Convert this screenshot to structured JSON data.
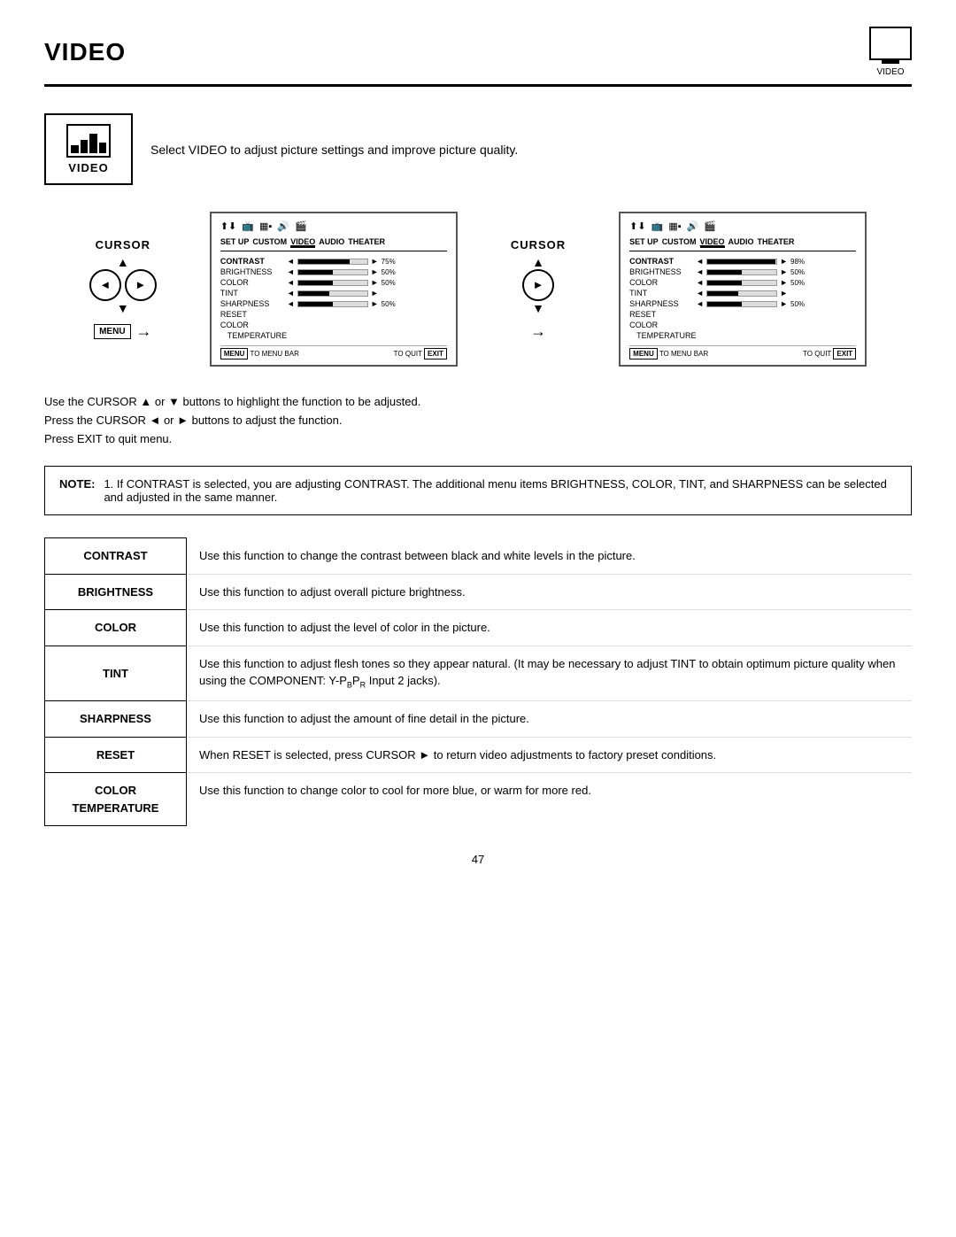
{
  "header": {
    "title": "VIDEO",
    "icon_label": "VIDEO"
  },
  "intro": {
    "video_label": "VIDEO",
    "description": "Select VIDEO to adjust picture settings and improve picture quality."
  },
  "diagram": {
    "cursor_label": "CURSOR",
    "menu_tag": "MENU",
    "screen1": {
      "nav": [
        "SET UP",
        "CUSTOM",
        "VIDEO",
        "AUDIO",
        "THEATER"
      ],
      "active_tab": "VIDEO",
      "rows": [
        {
          "label": "CONTRAST",
          "bold": true,
          "value": 75,
          "display": "75%"
        },
        {
          "label": "BRIGHTNESS",
          "bold": false,
          "value": 50,
          "display": "50%"
        },
        {
          "label": "COLOR",
          "bold": false,
          "value": 50,
          "display": "50%"
        },
        {
          "label": "TINT",
          "bold": false,
          "value": 40,
          "display": ""
        },
        {
          "label": "SHARPNESS",
          "bold": false,
          "value": 50,
          "display": "50%"
        },
        {
          "label": "RESET",
          "bold": false,
          "value": 0,
          "display": ""
        },
        {
          "label": "COLOR",
          "bold": false,
          "value": 0,
          "display": ""
        },
        {
          "label": "TEMPERATURE",
          "bold": false,
          "value": 0,
          "display": ""
        }
      ],
      "bottom_left": "MENU",
      "bottom_left_text": "TO MENU BAR",
      "bottom_right": "EXIT",
      "bottom_right_text": "TO QUIT"
    },
    "screen2": {
      "nav": [
        "SET UP",
        "CUSTOM",
        "VIDEO",
        "AUDIO",
        "THEATER"
      ],
      "active_tab": "VIDEO",
      "rows": [
        {
          "label": "CONTRAST",
          "bold": true,
          "value": 98,
          "display": "98%"
        },
        {
          "label": "BRIGHTNESS",
          "bold": false,
          "value": 50,
          "display": "50%"
        },
        {
          "label": "COLOR",
          "bold": false,
          "value": 50,
          "display": "50%"
        },
        {
          "label": "TINT",
          "bold": false,
          "value": 40,
          "display": ""
        },
        {
          "label": "SHARPNESS",
          "bold": false,
          "value": 50,
          "display": "50%"
        },
        {
          "label": "RESET",
          "bold": false,
          "value": 0,
          "display": ""
        },
        {
          "label": "COLOR",
          "bold": false,
          "value": 0,
          "display": ""
        },
        {
          "label": "TEMPERATURE",
          "bold": false,
          "value": 0,
          "display": ""
        }
      ],
      "bottom_left": "MENU",
      "bottom_left_text": "TO MENU BAR",
      "bottom_right": "EXIT",
      "bottom_right_text": "TO QUIT"
    }
  },
  "instructions": [
    "Use the CURSOR ▲ or ▼ buttons to highlight the function to be adjusted.",
    "Press the CURSOR ◄ or ► buttons to adjust the function.",
    "Press EXIT to quit menu."
  ],
  "note": {
    "label": "NOTE:",
    "points": [
      "1. If CONTRAST is selected, you are adjusting CONTRAST.  The additional menu items BRIGHTNESS, COLOR, TINT, and SHARPNESS can be selected and adjusted in the same manner."
    ]
  },
  "functions": [
    {
      "label": "CONTRAST",
      "description": "Use this function to change the contrast between black and white levels in the picture."
    },
    {
      "label": "BRIGHTNESS",
      "description": "Use this function to adjust overall picture brightness."
    },
    {
      "label": "COLOR",
      "description": "Use this function to adjust the level of color in the picture."
    },
    {
      "label": "TINT",
      "description": "Use this function to adjust flesh tones so they appear natural. (It may be necessary to adjust TINT to obtain optimum picture quality when using the COMPONENT: Y-PBP R Input 2 jacks)."
    },
    {
      "label": "SHARPNESS",
      "description": "Use this function to adjust the amount of fine detail in the picture."
    },
    {
      "label": "RESET",
      "description": "When RESET is selected, press CURSOR ► to return video adjustments to factory preset conditions."
    },
    {
      "label": "COLOR\nTEMPERATURE",
      "description": "Use this function to change color to cool for more blue, or warm for more red."
    }
  ],
  "page_number": "47"
}
